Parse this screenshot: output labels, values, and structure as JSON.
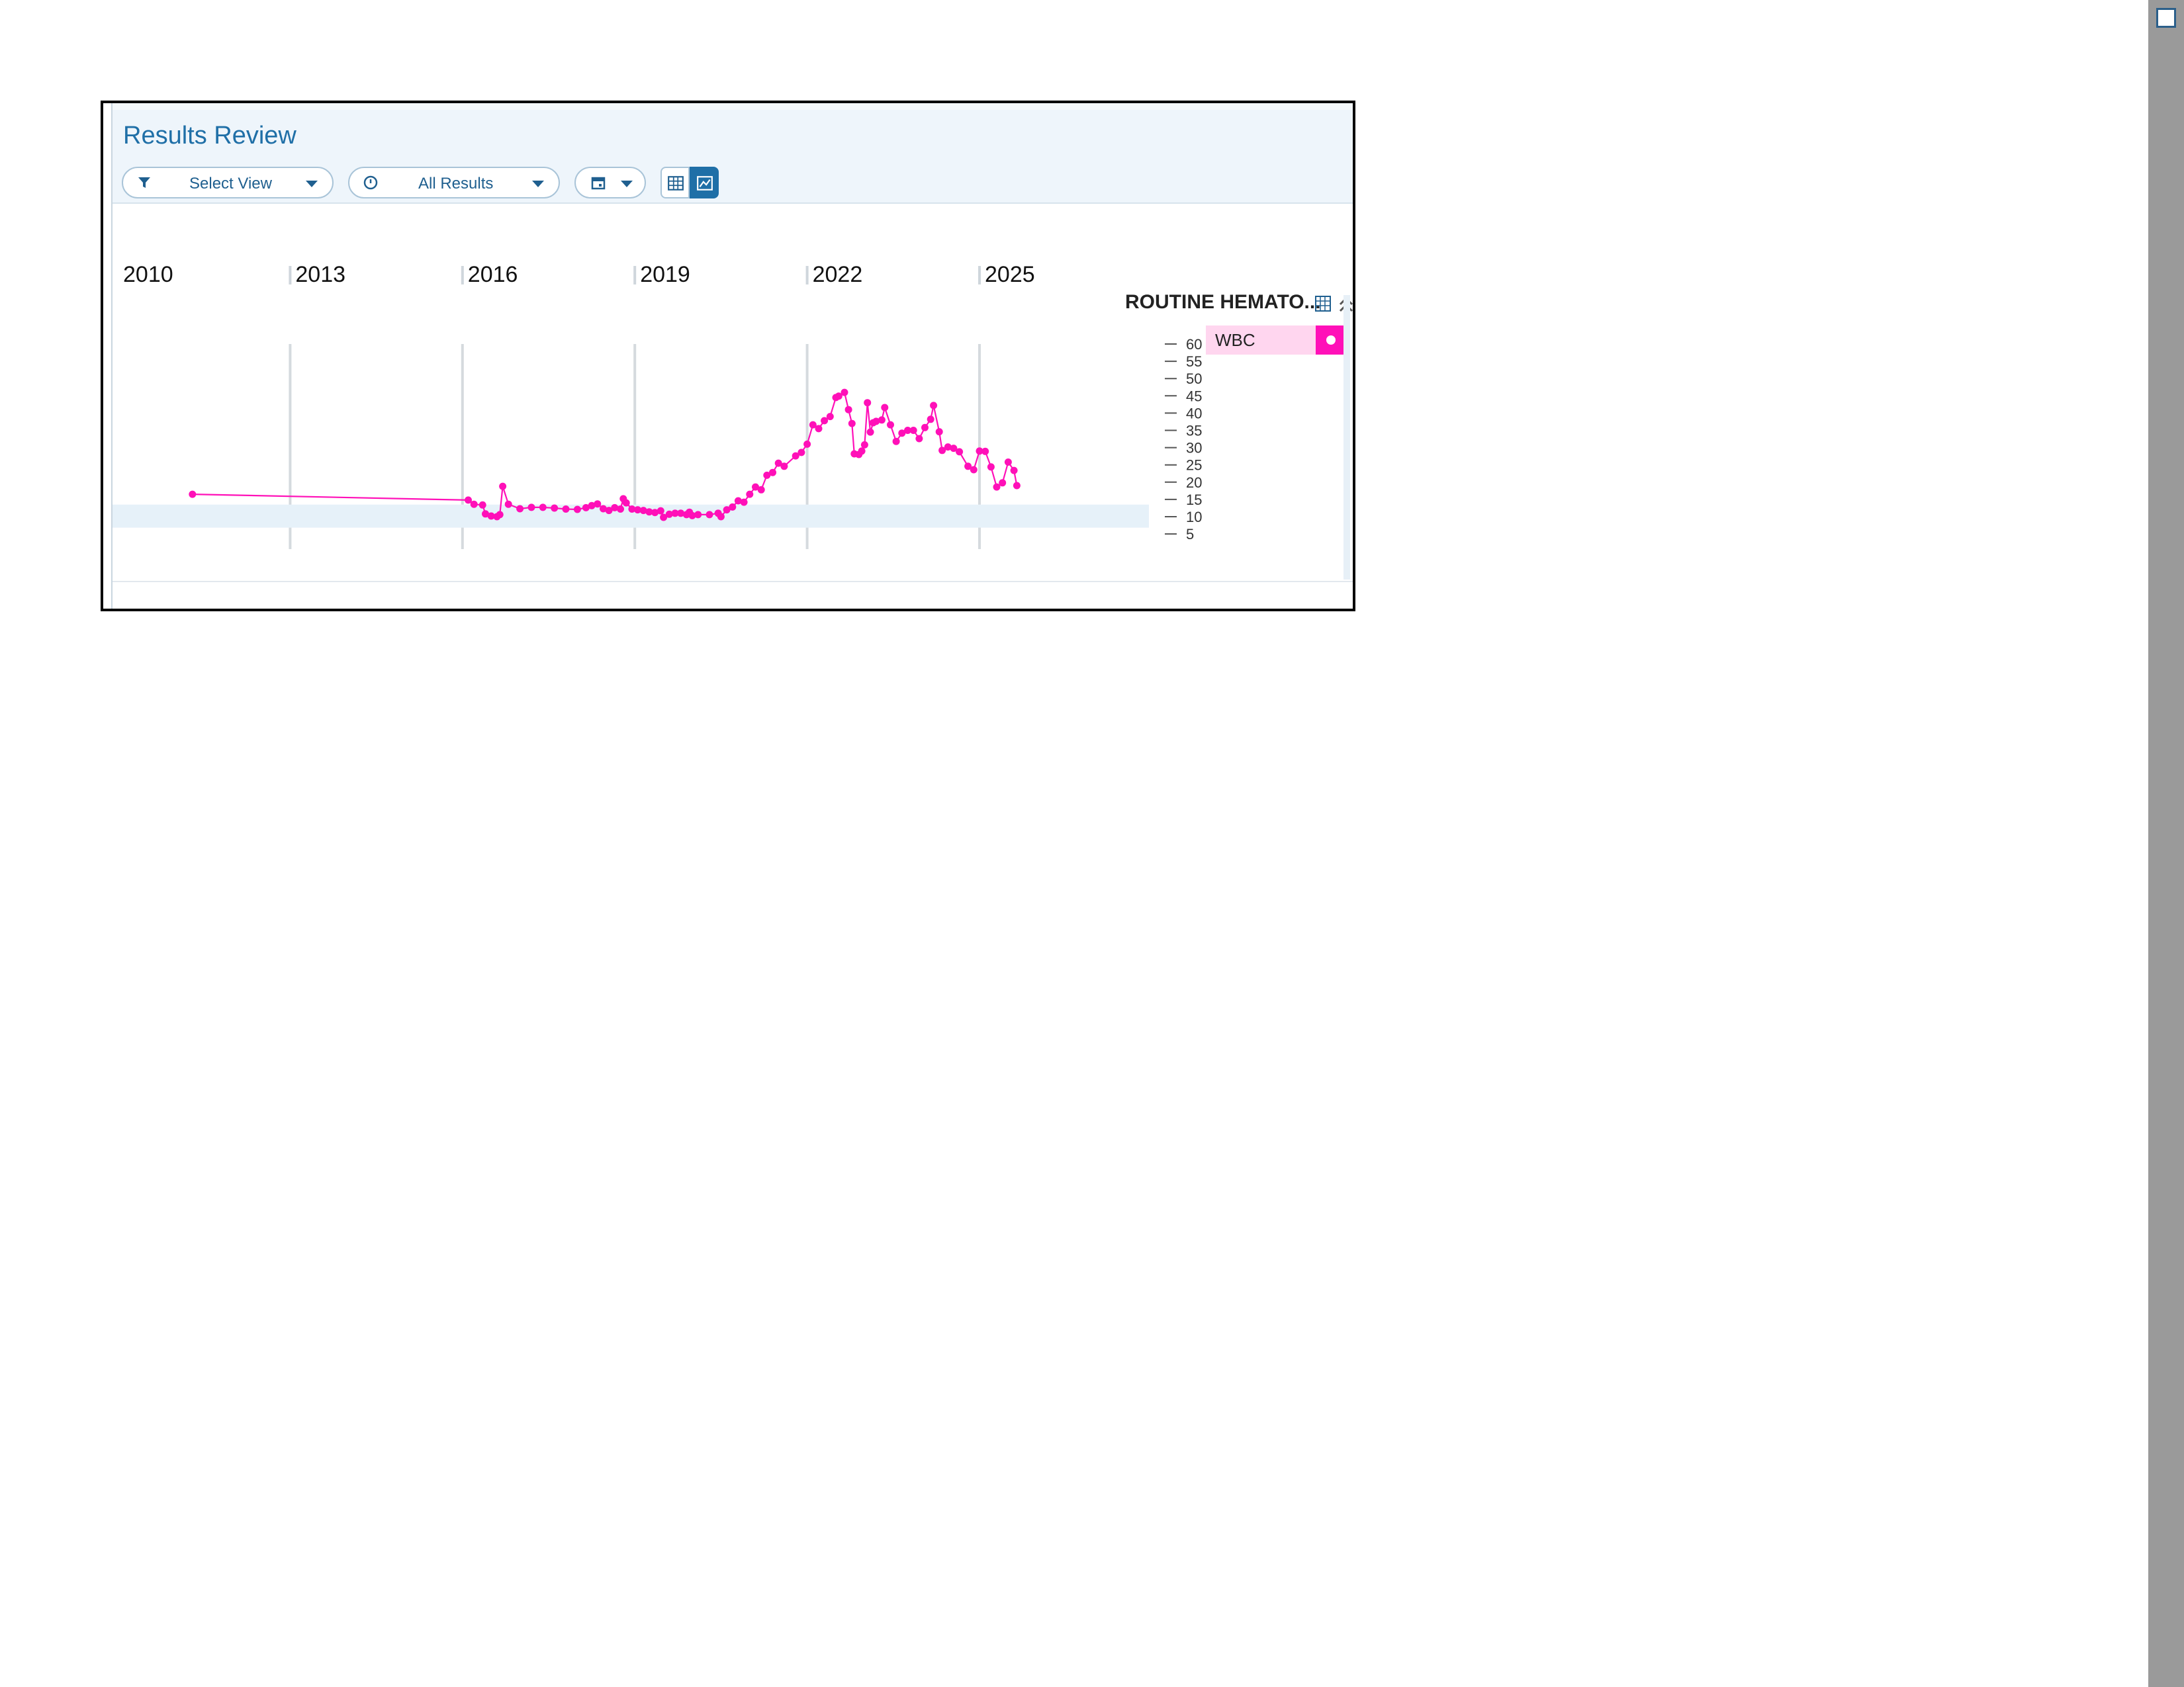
{
  "header": {
    "title": "Results Review",
    "view_filter": {
      "label": "Select View",
      "icon": "filter-icon"
    },
    "results_filter": {
      "label": "All Results",
      "icon": "clock-icon"
    },
    "date_button": {
      "icon": "calendar-icon"
    },
    "table_view_icon": "table-icon",
    "graph_view_icon": "chart-icon"
  },
  "legend": {
    "group_title": "ROUTINE HEMATO...",
    "grid_icon": "grid-icon",
    "collapse_icon": "double-chevron-up-icon",
    "series_label": "WBC",
    "series_color": "#ff10b8"
  },
  "chart_data": {
    "type": "line",
    "x_tick_labels": [
      "2010",
      "2013",
      "2016",
      "2019",
      "2022",
      "2025"
    ],
    "y_tick_labels": [
      "60",
      "55",
      "50",
      "45",
      "40",
      "35",
      "30",
      "25",
      "20",
      "15",
      "10",
      "5"
    ],
    "ylim": [
      0,
      60
    ],
    "xlim": [
      2010,
      2028
    ],
    "grid": true,
    "legend_position": "right",
    "series": [
      {
        "name": "WBC",
        "color": "#ff10b8",
        "points": [
          [
            2011.3,
            16.5
          ],
          [
            2016.1,
            14.8
          ],
          [
            2016.2,
            13.6
          ],
          [
            2016.35,
            13.4
          ],
          [
            2016.4,
            10.8
          ],
          [
            2016.5,
            10.2
          ],
          [
            2016.6,
            10.0
          ],
          [
            2016.65,
            10.6
          ],
          [
            2016.7,
            18.8
          ],
          [
            2016.8,
            13.6
          ],
          [
            2017.0,
            12.3
          ],
          [
            2017.2,
            12.7
          ],
          [
            2017.4,
            12.7
          ],
          [
            2017.6,
            12.5
          ],
          [
            2017.8,
            12.2
          ],
          [
            2018.0,
            12.1
          ],
          [
            2018.15,
            12.6
          ],
          [
            2018.25,
            13.2
          ],
          [
            2018.35,
            13.7
          ],
          [
            2018.45,
            12.3
          ],
          [
            2018.55,
            11.8
          ],
          [
            2018.65,
            12.6
          ],
          [
            2018.75,
            12.2
          ],
          [
            2018.8,
            15.2
          ],
          [
            2018.85,
            14.0
          ],
          [
            2018.95,
            12.2
          ],
          [
            2019.05,
            12.0
          ],
          [
            2019.15,
            11.8
          ],
          [
            2019.25,
            11.4
          ],
          [
            2019.35,
            11.2
          ],
          [
            2019.45,
            11.7
          ],
          [
            2019.5,
            9.8
          ],
          [
            2019.6,
            10.7
          ],
          [
            2019.7,
            11.0
          ],
          [
            2019.8,
            11.0
          ],
          [
            2019.9,
            10.6
          ],
          [
            2019.95,
            11.3
          ],
          [
            2020.0,
            10.3
          ],
          [
            2020.1,
            10.6
          ],
          [
            2020.3,
            10.6
          ],
          [
            2020.45,
            11.0
          ],
          [
            2020.5,
            10.0
          ],
          [
            2020.6,
            12.0
          ],
          [
            2020.7,
            12.8
          ],
          [
            2020.8,
            14.6
          ],
          [
            2020.9,
            14.2
          ],
          [
            2021.0,
            16.5
          ],
          [
            2021.1,
            18.6
          ],
          [
            2021.2,
            17.8
          ],
          [
            2021.3,
            22.0
          ],
          [
            2021.4,
            22.8
          ],
          [
            2021.5,
            25.5
          ],
          [
            2021.6,
            24.6
          ],
          [
            2021.8,
            27.6
          ],
          [
            2021.9,
            28.6
          ],
          [
            2022.0,
            31.0
          ],
          [
            2022.1,
            36.6
          ],
          [
            2022.2,
            35.5
          ],
          [
            2022.3,
            37.8
          ],
          [
            2022.4,
            39.0
          ],
          [
            2022.5,
            44.5
          ],
          [
            2022.55,
            44.9
          ],
          [
            2022.65,
            46.0
          ],
          [
            2022.72,
            41.0
          ],
          [
            2022.78,
            37.0
          ],
          [
            2022.82,
            28.2
          ],
          [
            2022.9,
            28.0
          ],
          [
            2022.95,
            29.0
          ],
          [
            2023.0,
            30.8
          ],
          [
            2023.05,
            43.0
          ],
          [
            2023.1,
            34.5
          ],
          [
            2023.15,
            37.2
          ],
          [
            2023.2,
            37.6
          ],
          [
            2023.3,
            38.0
          ],
          [
            2023.35,
            41.6
          ],
          [
            2023.45,
            36.6
          ],
          [
            2023.55,
            31.8
          ],
          [
            2023.65,
            34.2
          ],
          [
            2023.75,
            35.0
          ],
          [
            2023.85,
            35.0
          ],
          [
            2023.95,
            32.6
          ],
          [
            2024.05,
            35.8
          ],
          [
            2024.15,
            38.2
          ],
          [
            2024.2,
            42.2
          ],
          [
            2024.3,
            34.6
          ],
          [
            2024.35,
            29.2
          ],
          [
            2024.45,
            30.2
          ],
          [
            2024.55,
            29.8
          ],
          [
            2024.65,
            28.8
          ],
          [
            2024.8,
            24.6
          ],
          [
            2024.9,
            23.6
          ],
          [
            2025.0,
            29.0
          ],
          [
            2025.1,
            28.9
          ],
          [
            2025.2,
            24.4
          ],
          [
            2025.3,
            18.6
          ],
          [
            2025.4,
            19.8
          ],
          [
            2025.5,
            25.8
          ],
          [
            2025.6,
            23.4
          ],
          [
            2025.65,
            19.0
          ]
        ]
      }
    ]
  }
}
